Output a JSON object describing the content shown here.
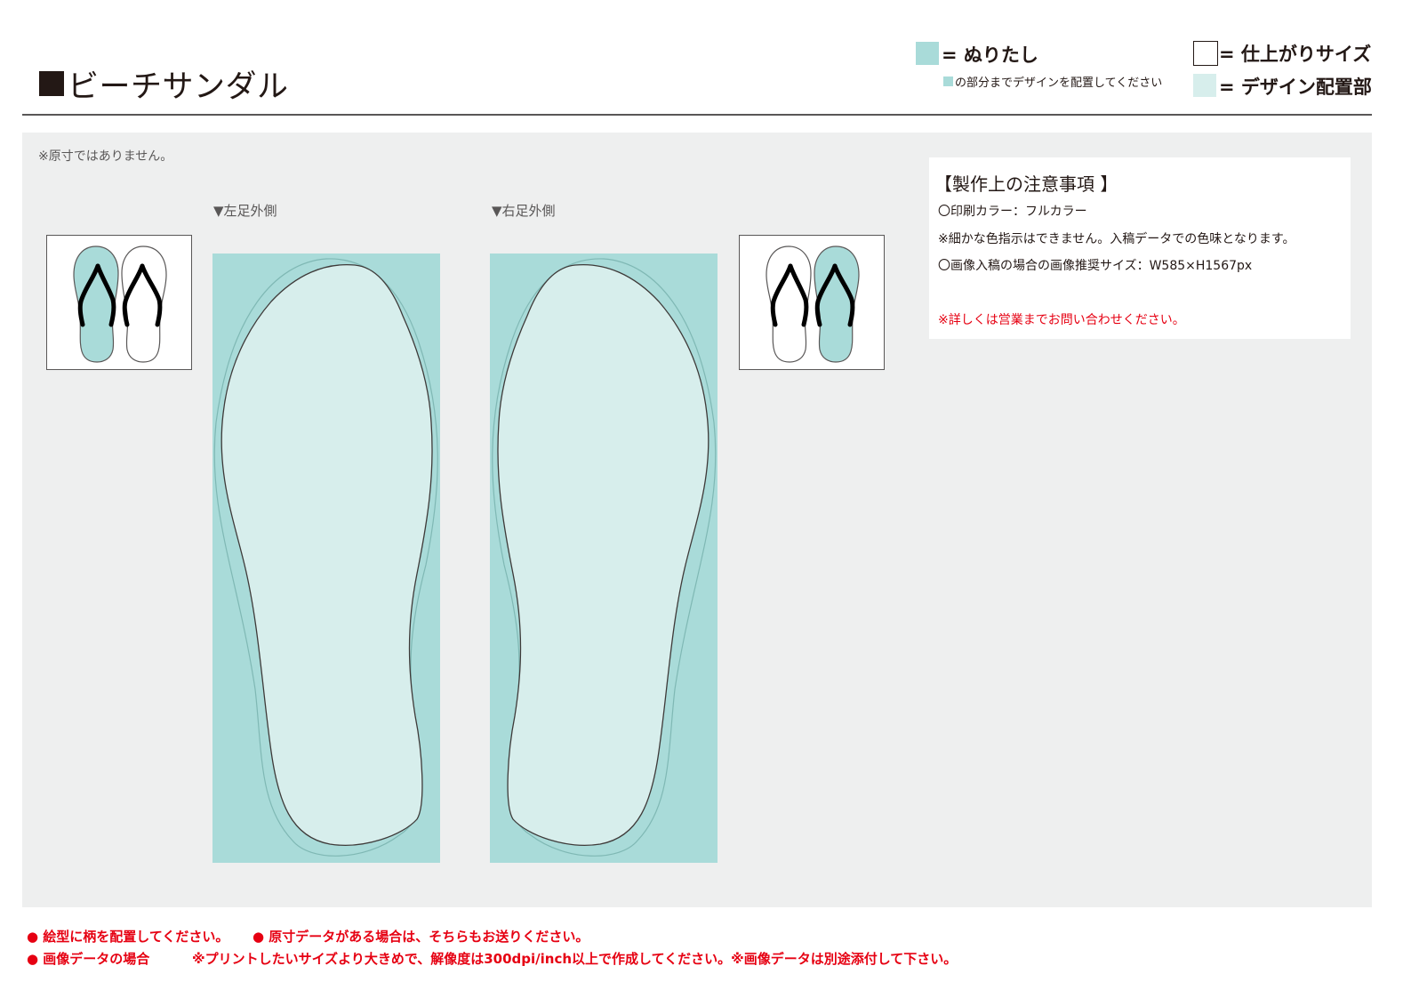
{
  "header": {
    "title": "ビーチサンダル"
  },
  "legend": {
    "bleed_label": "= ぬりたし",
    "bleed_note": "の部分までデザインを配置してください",
    "finish_label": "= 仕上がりサイズ",
    "design_label": "= デザイン配置部"
  },
  "main": {
    "scale_note": "※原寸ではありません。",
    "left_label": "▼左足外側",
    "right_label": "▼右足外側"
  },
  "notes": {
    "title": "【製作上の注意事項 】",
    "lines": [
      "〇印刷カラー：フルカラー",
      "※細かな色指示はできません。入稿データでの色味となります。",
      "〇画像入稿の場合の画像推奨サイズ：W585×H1567px"
    ],
    "red_line": "※詳しくは営業までお問い合わせください。"
  },
  "footer": {
    "line1_a": "● 絵型に柄を配置してください。",
    "line1_b": "● 原寸データがある場合は、そちらもお送りください。",
    "line2_a": "● 画像データの場合",
    "line2_b": "※プリントしたいサイズより大きめで、解像度は300dpi/inch以上で作成してください。※画像データは別途添付して下さい。"
  },
  "colors": {
    "bleed": "#a9dbd9",
    "design": "#d7eeec",
    "panel": "#eeefef",
    "text": "#231815",
    "red": "#e60012"
  },
  "icons": {
    "title_marker": "black-square-icon",
    "left_thumbnail": "left-sandal-highlight-icon",
    "right_thumbnail": "right-sandal-highlight-icon"
  }
}
